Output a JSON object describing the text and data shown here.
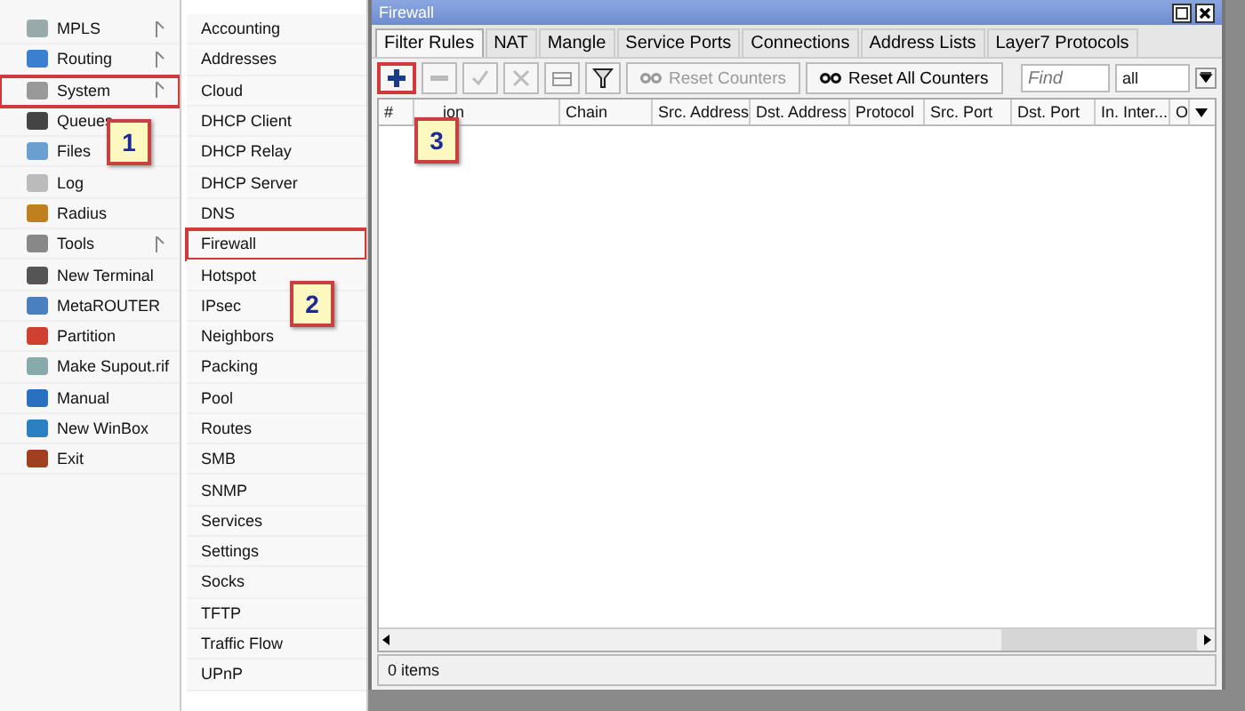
{
  "main_menu": [
    {
      "label": "MPLS",
      "submenu": true,
      "marked": false
    },
    {
      "label": "Routing",
      "submenu": true,
      "marked": false
    },
    {
      "label": "System",
      "submenu": true,
      "marked": true,
      "callout": "1"
    },
    {
      "label": "Queues",
      "submenu": false,
      "marked": false
    },
    {
      "label": "Files",
      "submenu": false,
      "marked": false
    },
    {
      "label": "Log",
      "submenu": false,
      "marked": false
    },
    {
      "label": "Radius",
      "submenu": false,
      "marked": false
    },
    {
      "label": "Tools",
      "submenu": true,
      "marked": false
    },
    {
      "label": "New Terminal",
      "submenu": false,
      "marked": false
    },
    {
      "label": "MetaROUTER",
      "submenu": false,
      "marked": false
    },
    {
      "label": "Partition",
      "submenu": false,
      "marked": false
    },
    {
      "label": "Make Supout.rif",
      "submenu": false,
      "marked": false
    },
    {
      "label": "Manual",
      "submenu": false,
      "marked": false
    },
    {
      "label": "New WinBox",
      "submenu": false,
      "marked": false
    },
    {
      "label": "Exit",
      "submenu": false,
      "marked": false
    }
  ],
  "submenu": [
    {
      "label": "Accounting",
      "marked": false
    },
    {
      "label": "Addresses",
      "marked": false
    },
    {
      "label": "Cloud",
      "marked": false
    },
    {
      "label": "DHCP Client",
      "marked": false
    },
    {
      "label": "DHCP Relay",
      "marked": false
    },
    {
      "label": "DHCP Server",
      "marked": false
    },
    {
      "label": "DNS",
      "marked": false
    },
    {
      "label": "Firewall",
      "marked": true,
      "callout": "2"
    },
    {
      "label": "Hotspot",
      "marked": false
    },
    {
      "label": "IPsec",
      "marked": false
    },
    {
      "label": "Neighbors",
      "marked": false
    },
    {
      "label": "Packing",
      "marked": false
    },
    {
      "label": "Pool",
      "marked": false
    },
    {
      "label": "Routes",
      "marked": false
    },
    {
      "label": "SMB",
      "marked": false
    },
    {
      "label": "SNMP",
      "marked": false
    },
    {
      "label": "Services",
      "marked": false
    },
    {
      "label": "Settings",
      "marked": false
    },
    {
      "label": "Socks",
      "marked": false
    },
    {
      "label": "TFTP",
      "marked": false
    },
    {
      "label": "Traffic Flow",
      "marked": false
    },
    {
      "label": "UPnP",
      "marked": false
    }
  ],
  "window": {
    "title": "Firewall",
    "tabs": [
      {
        "label": "Filter Rules",
        "selected": true
      },
      {
        "label": "NAT",
        "selected": false
      },
      {
        "label": "Mangle",
        "selected": false
      },
      {
        "label": "Service Ports",
        "selected": false
      },
      {
        "label": "Connections",
        "selected": false
      },
      {
        "label": "Address Lists",
        "selected": false
      },
      {
        "label": "Layer7 Protocols",
        "selected": false
      }
    ],
    "toolbar": [
      {
        "kind": "add",
        "disabled": false,
        "marked": true,
        "callout": "3"
      },
      {
        "kind": "remove",
        "disabled": true,
        "marked": false
      },
      {
        "kind": "enable",
        "disabled": true,
        "marked": false
      },
      {
        "kind": "disable",
        "disabled": true,
        "marked": false
      },
      {
        "kind": "comment",
        "disabled": true,
        "marked": false
      },
      {
        "kind": "filter",
        "disabled": false,
        "marked": false
      },
      {
        "kind": "text",
        "label": "Reset Counters",
        "disabled": true,
        "marked": false
      },
      {
        "kind": "text",
        "label": "Reset All Counters",
        "disabled": false,
        "marked": false
      }
    ],
    "find": {
      "placeholder": "Find"
    },
    "filter_select": {
      "value": "all"
    },
    "columns": [
      "#",
      "ion",
      "Chain",
      "Src. Address",
      "Dst. Address",
      "Protocol",
      "Src. Port",
      "Dst. Port",
      "In. Inter...",
      "O"
    ],
    "status_bar": "0 items"
  }
}
